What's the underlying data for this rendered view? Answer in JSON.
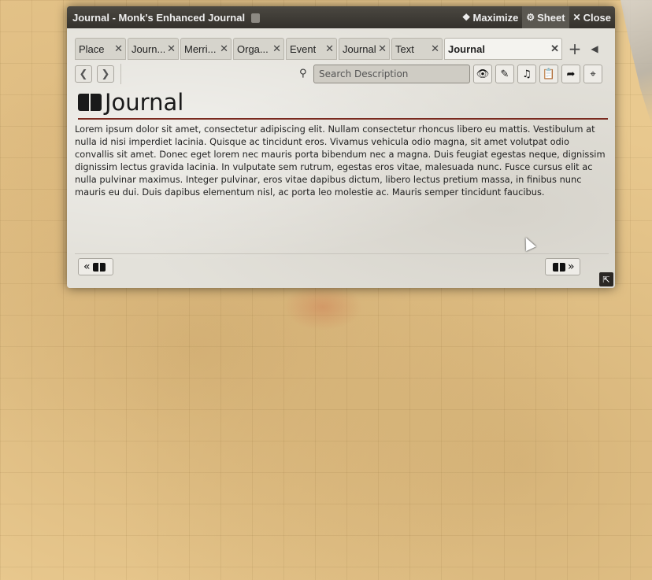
{
  "window": {
    "title": "Journal - Monk's Enhanced Journal",
    "buttons": {
      "maximize": "Maximize",
      "sheet": "Sheet",
      "close": "Close"
    }
  },
  "tabs": [
    {
      "label": "Place",
      "active": false
    },
    {
      "label": "Journ...",
      "active": false
    },
    {
      "label": "Merri...",
      "active": false
    },
    {
      "label": "Orga...",
      "active": false
    },
    {
      "label": "Event",
      "active": false
    },
    {
      "label": "Journal",
      "active": false
    },
    {
      "label": "Text",
      "active": false
    },
    {
      "label": "Journal",
      "active": true
    }
  ],
  "toolbar": {
    "search_placeholder": "Search Description",
    "icons": [
      "eye-icon",
      "pencil-icon",
      "music-icon",
      "clipboard-icon",
      "export-icon",
      "crosshair-icon"
    ]
  },
  "page": {
    "title": "Journal",
    "description": "Lorem ipsum dolor sit amet, consectetur adipiscing elit. Nullam consectetur rhoncus libero eu mattis. Vestibulum at nulla id nisi imperdiet lacinia. Quisque ac tincidunt eros. Vivamus vehicula odio magna, sit amet volutpat odio convallis sit amet. Donec eget lorem nec mauris porta bibendum nec a magna. Duis feugiat egestas neque, dignissim dignissim lectus gravida lacinia. In vulputate sem rutrum, egestas eros vitae, malesuada nunc. Fusce cursus elit ac nulla pulvinar maximus. Integer pulvinar, eros vitae dapibus dictum, libero lectus pretium massa, in finibus nunc mauris eu dui. Duis dapibus elementum nisl, ac porta leo molestie ac. Mauris semper tincidunt faucibus."
  },
  "colors": {
    "header_bg": "#3d3a34",
    "title_rule": "#7a2a1f",
    "map_bg": "#e9c98f"
  }
}
